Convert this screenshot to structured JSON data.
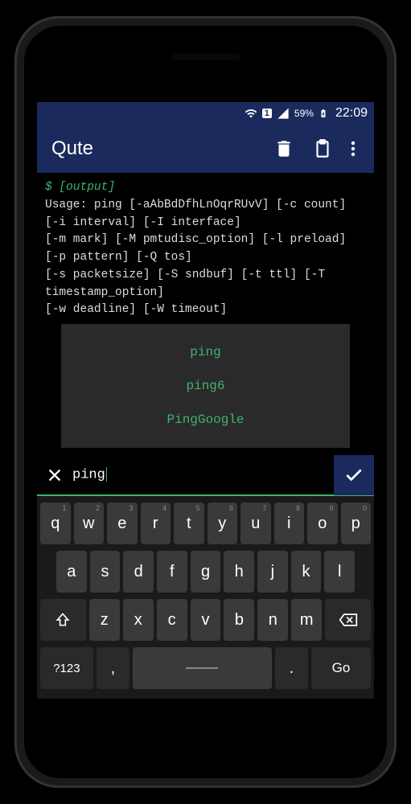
{
  "status": {
    "battery": "59%",
    "time": "22:09",
    "sim": "1"
  },
  "appbar": {
    "title": "Qute"
  },
  "terminal": {
    "prompt": "$ [output]",
    "lines": [
      "Usage: ping [-aAbBdDfhLnOqrRUvV] [-c count] [-i interval] [-I interface]",
      "            [-m mark] [-M pmtudisc_option] [-l preload] [-p pattern] [-Q tos]",
      "            [-s packetsize] [-S sndbuf] [-t ttl] [-T timestamp_option]",
      "            [-w deadline] [-W timeout]"
    ]
  },
  "suggestions": [
    "ping",
    "ping6",
    "PingGoogle"
  ],
  "input": {
    "value": "ping"
  },
  "keyboard": {
    "row1": [
      {
        "k": "q",
        "s": "1"
      },
      {
        "k": "w",
        "s": "2"
      },
      {
        "k": "e",
        "s": "3"
      },
      {
        "k": "r",
        "s": "4"
      },
      {
        "k": "t",
        "s": "5"
      },
      {
        "k": "y",
        "s": "6"
      },
      {
        "k": "u",
        "s": "7"
      },
      {
        "k": "i",
        "s": "8"
      },
      {
        "k": "o",
        "s": "9"
      },
      {
        "k": "p",
        "s": "0"
      }
    ],
    "row2": [
      "a",
      "s",
      "d",
      "f",
      "g",
      "h",
      "j",
      "k",
      "l"
    ],
    "row3": [
      "z",
      "x",
      "c",
      "v",
      "b",
      "n",
      "m"
    ],
    "row4": {
      "sym": "?123",
      "comma": ",",
      "period": ".",
      "go": "Go"
    }
  }
}
